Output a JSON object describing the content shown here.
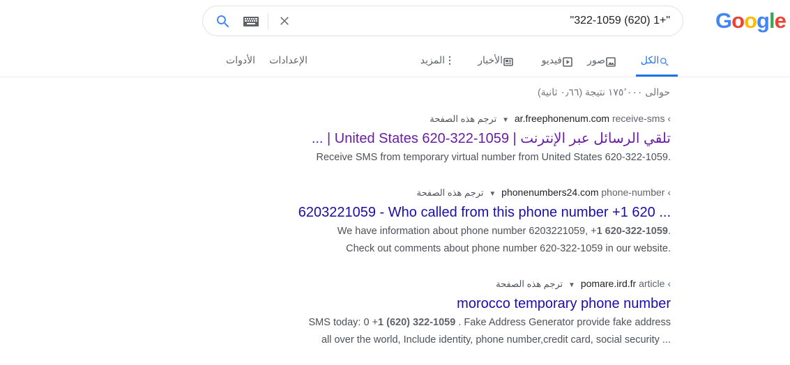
{
  "logo": {
    "letters": [
      "G",
      "o",
      "o",
      "g",
      "l",
      "e"
    ]
  },
  "search": {
    "query": "\"322-1059 (620) 1+\""
  },
  "tabs": {
    "all": "الكل",
    "images": "صور",
    "videos": "فيديو",
    "news": "الأخبار",
    "more": "المزيد",
    "settings": "الإعدادات",
    "tools": "الأدوات"
  },
  "stats": "حوالى ١٧٥٬٠٠٠ نتيجة (٠٫٦٦ ثانية)",
  "results": [
    {
      "domain": "ar.freephonenum.com",
      "path": "receive-sms ‹",
      "translate": "ترجم هذه الصفحة",
      "title": "تلقي الرسائل عبر الإنترنت | United States 620-322-1059 | ...",
      "snippet_lines": [
        "Receive SMS from temporary virtual number from United States 620-322-1059."
      ]
    },
    {
      "domain": "phonenumbers24.com",
      "path": "phone-number ‹",
      "translate": "ترجم هذه الصفحة",
      "title": "6203221059 - Who called from this phone number +1 620 ...",
      "snippet_pre": "We have information about phone number 6203221059, +",
      "snippet_bold": "1 620-322-1059",
      "snippet_post": ".",
      "snippet_line2": "Check out comments about phone number 620-322-1059 in our website."
    },
    {
      "domain": "pomare.ird.fr",
      "path": "article ‹",
      "translate": "ترجم هذه الصفحة",
      "title": "morocco temporary phone number",
      "snippet_pre": "SMS today: 0 +",
      "snippet_bold": "1 (620) 322-1059",
      "snippet_post": " . Fake Address Generator provide fake address",
      "snippet_line2": "all over the world, Include identity, phone number,credit card, social security ..."
    }
  ],
  "colors": {
    "accent": "#1a73e8",
    "link": "#1a0dab",
    "visited": "#681da8",
    "snippet": "#4d5156"
  }
}
